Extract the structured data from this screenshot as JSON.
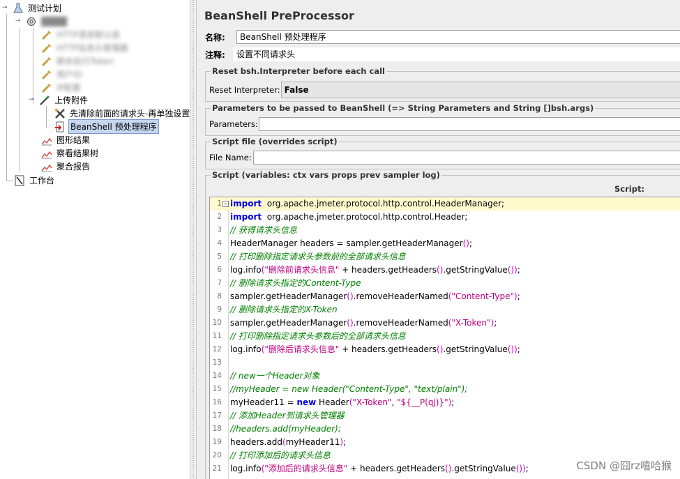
{
  "tree": {
    "root_label": "测试计划",
    "thread_group_label": "████",
    "blurred_items": [
      "HTTP请求默认值",
      "HTTP信息头管理器",
      "脚本执行Token",
      "用户ID",
      "IP配置"
    ],
    "upload_label": "上传附件",
    "clear_headers_label": "先清除前面的请求头-再单独设置",
    "beanshell_label": "BeanShell 预处理程序",
    "graph_label": "图形结果",
    "view_tree_label": "察看结果树",
    "aggregate_label": "聚合报告",
    "workbench_label": "工作台"
  },
  "panel": {
    "title": "BeanShell PreProcessor",
    "name_label": "名称:",
    "name_value": "BeanShell 预处理程序",
    "comment_label": "注释:",
    "comment_value": "设置不同请求头",
    "reset_group_title": "Reset bsh.Interpreter before each call",
    "reset_label": "Reset Interpreter:",
    "reset_value": "False",
    "params_group_title": "Parameters to be passed to BeanShell (=> String Parameters and String []bsh.args)",
    "params_label": "Parameters:",
    "params_value": "",
    "file_group_title": "Script file (overrides script)",
    "file_label": "File Name:",
    "file_value": "",
    "script_group_title": "Script (variables: ctx vars props prev sampler log)",
    "script_label": "Script:"
  },
  "code_lines": [
    {
      "n": "1",
      "segs": [
        [
          "kw",
          "import"
        ],
        [
          "",
          "  org.apache.jmeter.protocol.http.control.HeaderManager;"
        ]
      ]
    },
    {
      "n": "2",
      "segs": [
        [
          "kw",
          "import"
        ],
        [
          "",
          "  org.apache.jmeter.protocol.http.control.Header;"
        ]
      ]
    },
    {
      "n": "3",
      "segs": [
        [
          "cm",
          "// 获得请求头信息"
        ]
      ]
    },
    {
      "n": "4",
      "segs": [
        [
          "",
          "HeaderManager headers = sampler.getHeaderManager"
        ],
        [
          "par",
          "()"
        ],
        [
          "",
          ";"
        ]
      ]
    },
    {
      "n": "5",
      "segs": [
        [
          "cm",
          "// 打印删除指定请求头参数前的全部请求头信息"
        ]
      ]
    },
    {
      "n": "6",
      "segs": [
        [
          "",
          "log.info"
        ],
        [
          "par",
          "("
        ],
        [
          "str",
          "\"删除前请求头信息\""
        ],
        [
          "",
          " + headers.getHeaders"
        ],
        [
          "par",
          "()"
        ],
        [
          "",
          ".getStringValue"
        ],
        [
          "par",
          "()"
        ],
        [
          "par",
          ")"
        ],
        [
          "",
          ";"
        ]
      ]
    },
    {
      "n": "7",
      "segs": [
        [
          "cm",
          "// 删除请求头指定的Content-Type"
        ]
      ]
    },
    {
      "n": "8",
      "segs": [
        [
          "",
          "sampler.getHeaderManager"
        ],
        [
          "par",
          "()"
        ],
        [
          "",
          ".removeHeaderNamed"
        ],
        [
          "par",
          "("
        ],
        [
          "str",
          "\"Content-Type\""
        ],
        [
          "par",
          ")"
        ],
        [
          "",
          ";"
        ]
      ]
    },
    {
      "n": "9",
      "segs": [
        [
          "cm",
          "// 删除请求头指定的X-Token"
        ]
      ]
    },
    {
      "n": "10",
      "segs": [
        [
          "",
          "sampler.getHeaderManager"
        ],
        [
          "par",
          "()"
        ],
        [
          "",
          ".removeHeaderNamed"
        ],
        [
          "par",
          "("
        ],
        [
          "str",
          "\"X-Token\""
        ],
        [
          "par",
          ")"
        ],
        [
          "",
          ";"
        ]
      ]
    },
    {
      "n": "11",
      "segs": [
        [
          "cm",
          "// 打印删除指定请求头参数后的全部请求头信息"
        ]
      ]
    },
    {
      "n": "12",
      "segs": [
        [
          "",
          "log.info"
        ],
        [
          "par",
          "("
        ],
        [
          "str",
          "\"删除后请求头信息\""
        ],
        [
          "",
          " + headers.getHeaders"
        ],
        [
          "par",
          "()"
        ],
        [
          "",
          ".getStringValue"
        ],
        [
          "par",
          "()"
        ],
        [
          "par",
          ")"
        ],
        [
          "",
          ";"
        ]
      ]
    },
    {
      "n": "13",
      "segs": []
    },
    {
      "n": "14",
      "segs": [
        [
          "cm",
          "// new一个Header对象"
        ]
      ]
    },
    {
      "n": "15",
      "segs": [
        [
          "cm",
          "//myHeader = new Header(\"Content-Type\", \"text/plain\");"
        ]
      ]
    },
    {
      "n": "16",
      "segs": [
        [
          "",
          "myHeader11 = "
        ],
        [
          "kw",
          "new"
        ],
        [
          "",
          " Header"
        ],
        [
          "par",
          "("
        ],
        [
          "str",
          "\"X-Token\""
        ],
        [
          "",
          ", "
        ],
        [
          "str",
          "\"${__P(qj)}\""
        ],
        [
          "par",
          ")"
        ],
        [
          "",
          ";"
        ]
      ]
    },
    {
      "n": "17",
      "segs": [
        [
          "cm",
          "// 添加Header到请求头管理器"
        ]
      ]
    },
    {
      "n": "18",
      "segs": [
        [
          "cm",
          "//headers.add(myHeader);"
        ]
      ]
    },
    {
      "n": "19",
      "segs": [
        [
          "",
          "headers.add"
        ],
        [
          "par",
          "("
        ],
        [
          "",
          "myHeader11"
        ],
        [
          "par",
          ")"
        ],
        [
          "",
          ";"
        ]
      ]
    },
    {
      "n": "20",
      "segs": [
        [
          "cm",
          "// 打印添加后的请求头信息"
        ]
      ]
    },
    {
      "n": "21",
      "segs": [
        [
          "",
          "log.info"
        ],
        [
          "par",
          "("
        ],
        [
          "str",
          "\"添加后的请求头信息\""
        ],
        [
          "",
          " + headers.getHeaders"
        ],
        [
          "par",
          "()"
        ],
        [
          "",
          ".getStringValue"
        ],
        [
          "par",
          "()"
        ],
        [
          "par",
          ")"
        ],
        [
          "",
          ";"
        ]
      ]
    }
  ],
  "watermark": "CSDN @囧rz嘻哈猴",
  "colors": {
    "selection": "#c5d6ef",
    "current_line": "#fffacd",
    "keyword": "#0000dd",
    "comment": "#008000",
    "string": "#bf0080"
  }
}
